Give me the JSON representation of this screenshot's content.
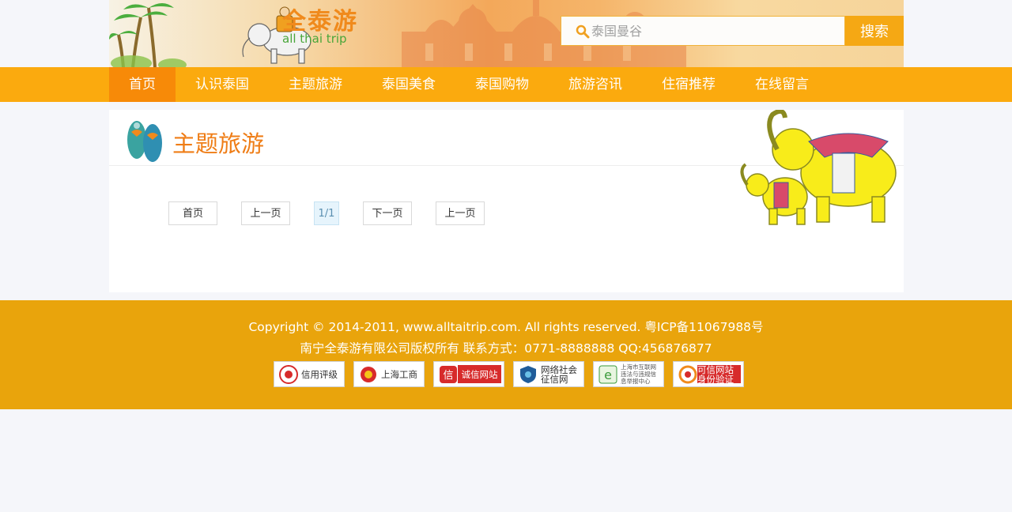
{
  "header": {
    "logo_cn": "全泰游",
    "logo_en": "all thai trip",
    "search_placeholder": "泰国曼谷",
    "search_button": "搜索"
  },
  "nav": {
    "items": [
      {
        "label": "首页",
        "active": true
      },
      {
        "label": "认识泰国"
      },
      {
        "label": "主题旅游"
      },
      {
        "label": "泰国美食"
      },
      {
        "label": "泰国购物"
      },
      {
        "label": "旅游咨讯"
      },
      {
        "label": "住宿推荐"
      },
      {
        "label": "在线留言"
      }
    ]
  },
  "content": {
    "title": "主题旅游",
    "pager": {
      "first": "首页",
      "prev": "上一页",
      "current": "1/1",
      "next": "下一页",
      "last": "上一页"
    }
  },
  "footer": {
    "copyright": "Copyright © 2014-2011, www.alltaitrip.com. All rights reserved. 粤ICP备11067988号",
    "company": "南宁全泰游有限公司版权所有 联系方式：0771-8888888 QQ:456876877",
    "badges": [
      {
        "label": "信用评级",
        "icon": "credit-seal-icon"
      },
      {
        "label": "上海工商",
        "icon": "police-emblem-icon"
      },
      {
        "label": "诚信网站",
        "icon": "trust-icon"
      },
      {
        "label": "网络社会征信网",
        "icon": "shield-icon"
      },
      {
        "label": "上海市互联网违法与违规信息举报中心",
        "icon": "report-e-icon"
      },
      {
        "label": "可信网站身份验证",
        "icon": "verified-site-icon"
      }
    ]
  },
  "colors": {
    "nav": "#fbaa0e",
    "nav_active": "#f78a08",
    "footer": "#e9a40c",
    "title": "#ef7d16"
  }
}
